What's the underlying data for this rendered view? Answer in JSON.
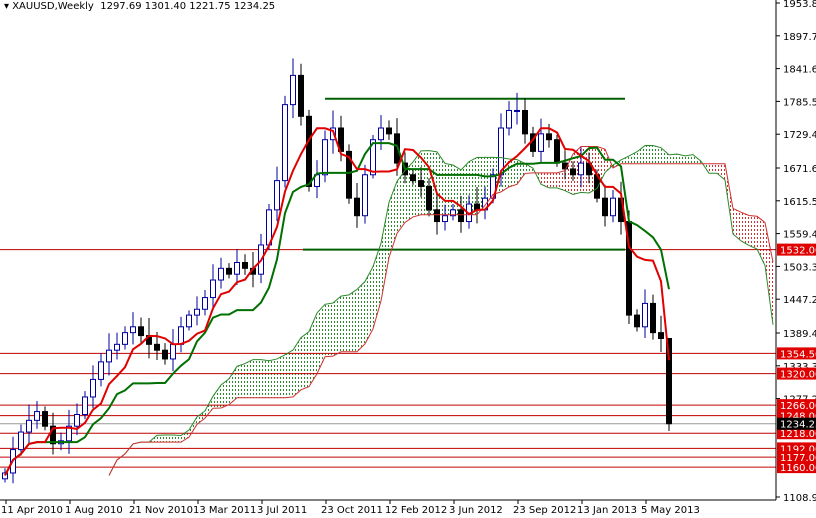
{
  "header": {
    "symbol": "XAUUSD,Weekly",
    "ohlc": "1297.69 1301.40 1221.75 1234.25"
  },
  "chart_data": {
    "type": "candlestick",
    "title": "XAUUSD,Weekly",
    "ylim": [
      1108.9,
      1953.8
    ],
    "price_ticks": [
      "1953.80",
      "1897.70",
      "1841.60",
      "1785.50",
      "1729.40",
      "1671.60",
      "1615.50",
      "1559.40",
      "1503.30",
      "1447.20",
      "1389.40",
      "1333.30",
      "1277.20",
      "1108.90"
    ],
    "date_labels": [
      "11 Apr 2010",
      "1 Aug 2010",
      "21 Nov 2010",
      "13 Mar 2011",
      "3 Jul 2011",
      "23 Oct 2011",
      "12 Feb 2012",
      "3 Jun 2012",
      "23 Sep 2012",
      "13 Jan 2013",
      "5 May 2013"
    ],
    "closes_biweekly": [
      1150,
      1190,
      1220,
      1240,
      1255,
      1230,
      1200,
      1205,
      1230,
      1250,
      1280,
      1310,
      1340,
      1360,
      1370,
      1390,
      1400,
      1385,
      1370,
      1360,
      1345,
      1370,
      1400,
      1420,
      1430,
      1450,
      1480,
      1500,
      1490,
      1510,
      1500,
      1490,
      1540,
      1600,
      1650,
      1780,
      1830,
      1760,
      1640,
      1660,
      1720,
      1740,
      1700,
      1620,
      1590,
      1660,
      1720,
      1740,
      1730,
      1680,
      1660,
      1650,
      1640,
      1600,
      1580,
      1590,
      1600,
      1580,
      1610,
      1600,
      1620,
      1660,
      1740,
      1770,
      1770,
      1730,
      1700,
      1730,
      1720,
      1680,
      1670,
      1660,
      1680,
      1660,
      1620,
      1590,
      1620,
      1580,
      1420,
      1400,
      1440,
      1390,
      1380,
      1234.25
    ],
    "levels": [
      "1532.00",
      "1354.50",
      "1320.00",
      "1266.00",
      "1248.00",
      "1218.00",
      "1192.00",
      "1177.00",
      "1160.00"
    ],
    "current_price": "1234.25",
    "range_box": {
      "top": 1790,
      "bottom": 1532
    },
    "colors": {
      "bull": "#0000a0",
      "bear": "#000000",
      "tenkan": "#e00000",
      "kijun": "#007000",
      "level": "#c00000",
      "level_label": "#e00000",
      "cloud_up": "#2a8a2a",
      "cloud_down": "#d03030"
    }
  }
}
